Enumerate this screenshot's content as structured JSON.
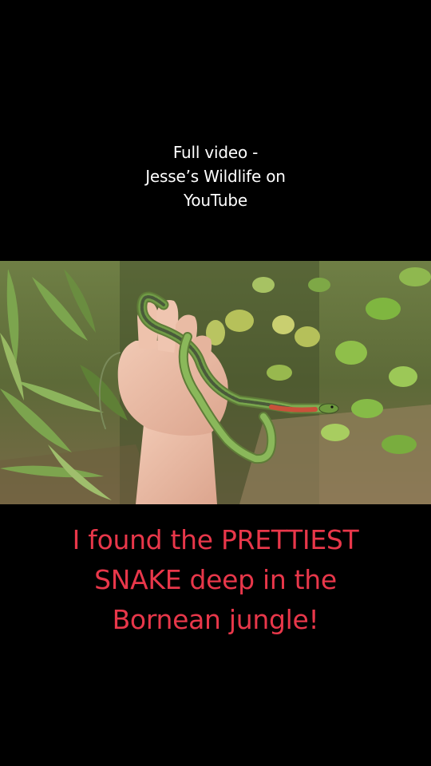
{
  "overlay": {
    "top_caption": {
      "line1": "Full video -",
      "line2": "Jesse’s Wildlife on",
      "line3": "YouTube"
    },
    "bottom_caption": {
      "line1": "I found the PRETTIEST",
      "line2": "SNAKE deep in the",
      "line3": "Bornean jungle!",
      "color": "#e8374a"
    }
  },
  "photo": {
    "subject": "green-snake-held-in-hand",
    "background": "jungle-foliage"
  }
}
